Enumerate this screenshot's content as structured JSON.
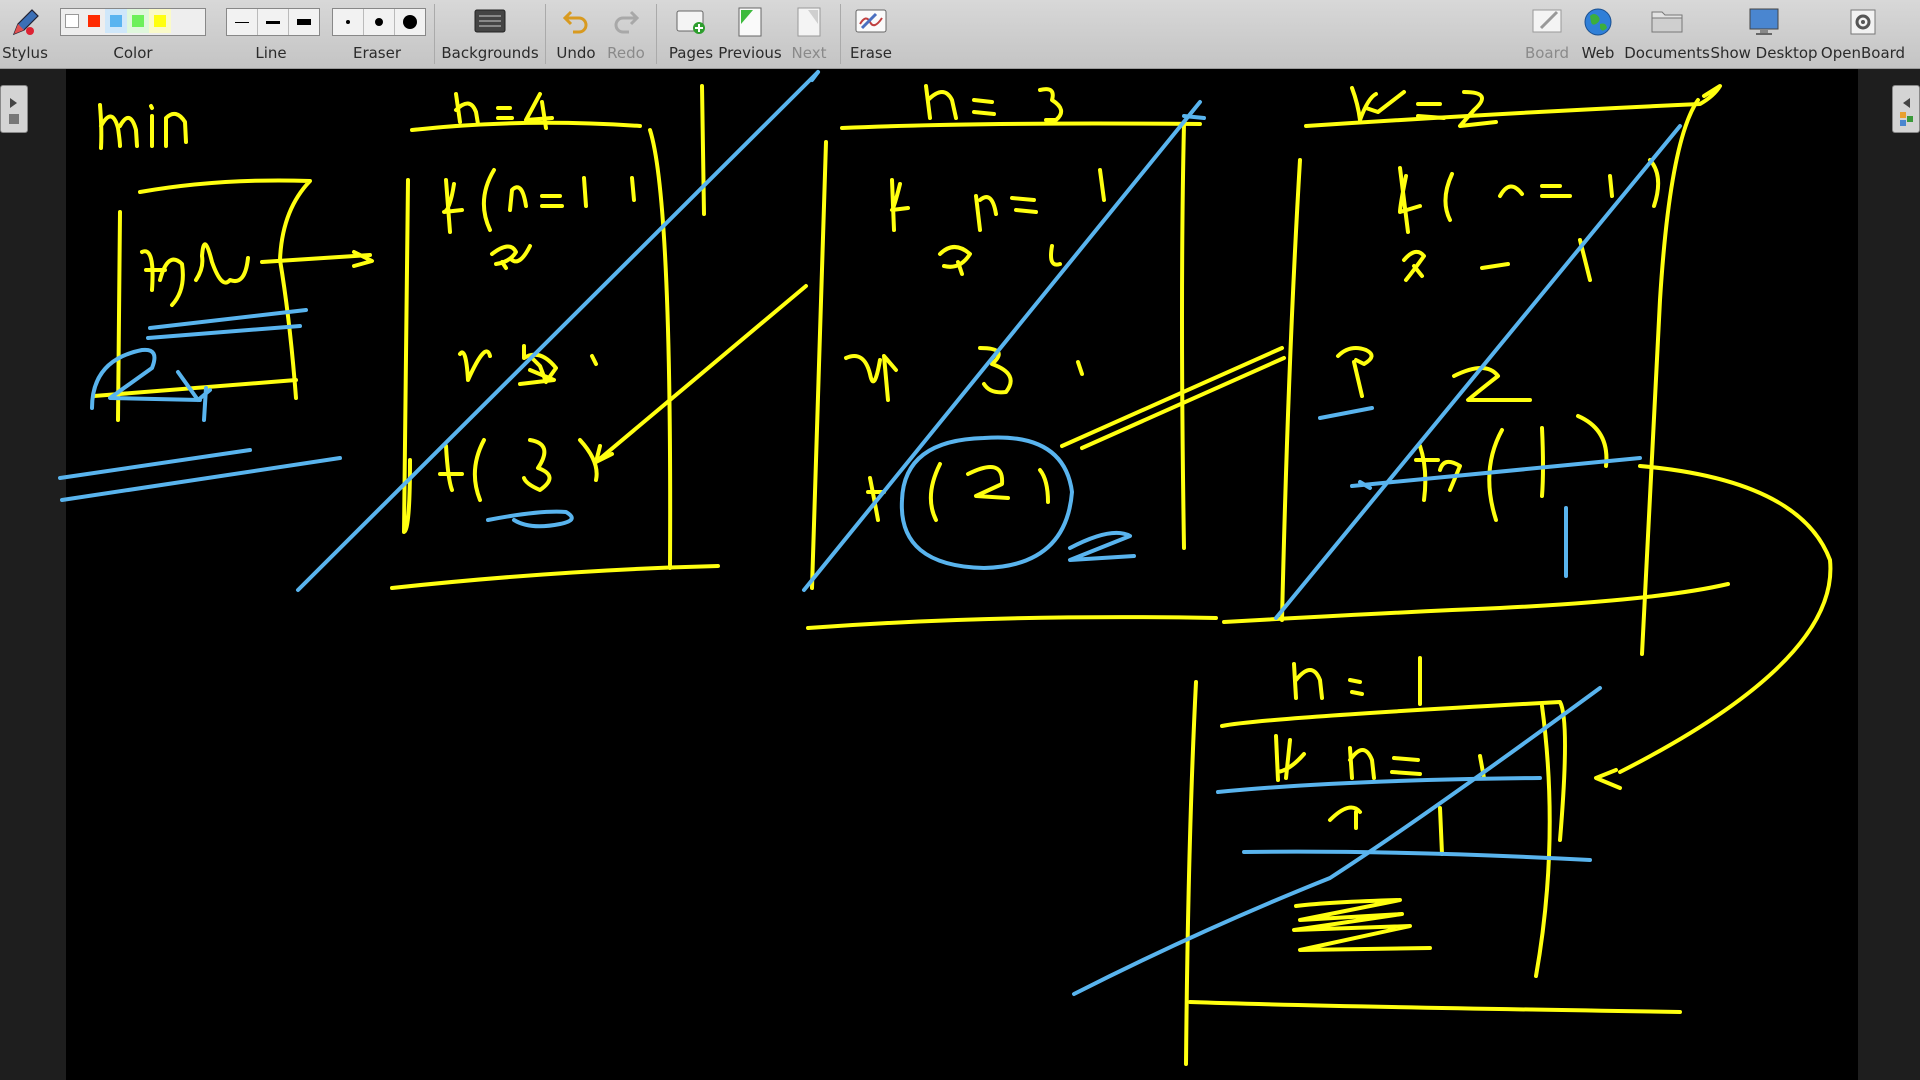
{
  "toolbar": {
    "stylus": "Stylus",
    "color": "Color",
    "line": "Line",
    "eraser": "Eraser",
    "backgrounds": "Backgrounds",
    "undo": "Undo",
    "redo": "Redo",
    "pages": "Pages",
    "previous": "Previous",
    "next": "Next",
    "erase": "Erase",
    "board": "Board",
    "web": "Web",
    "documents": "Documents",
    "show_desktop": "Show Desktop",
    "openboard": "OpenBoard"
  },
  "palette_colors": [
    "#ffffff",
    "#ff2a00",
    "#5ab4f0",
    "#6cf05a",
    "#ffff10"
  ],
  "ink_colors": {
    "yellow": "#ffff10",
    "blue": "#59b4ee"
  }
}
